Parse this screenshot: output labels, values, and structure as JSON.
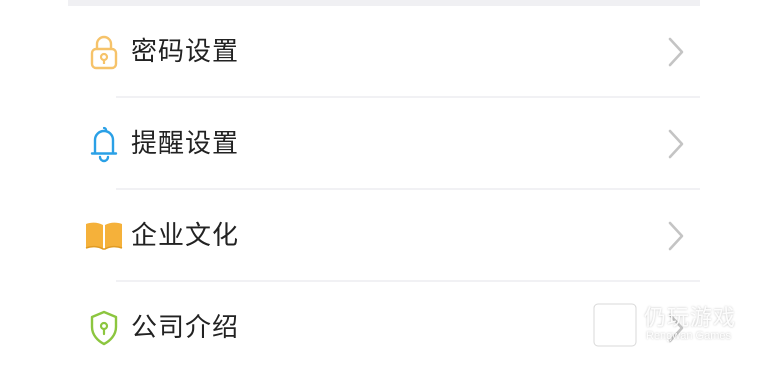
{
  "menu": {
    "items": [
      {
        "label": "密码设置",
        "icon": "lock-icon",
        "icon_color": "#f6c36a"
      },
      {
        "label": "提醒设置",
        "icon": "bell-icon",
        "icon_color": "#2aa0e6"
      },
      {
        "label": "企业文化",
        "icon": "book-icon",
        "icon_color": "#f5b13a"
      },
      {
        "label": "公司介绍",
        "icon": "shield-icon",
        "icon_color": "#8cc63f"
      }
    ]
  },
  "watermark": {
    "name": "仍玩游戏",
    "sub": "Rengwan Games"
  },
  "colors": {
    "text": "#222222",
    "chevron": "#c4c4c4",
    "divider": "#f1f1f4"
  }
}
